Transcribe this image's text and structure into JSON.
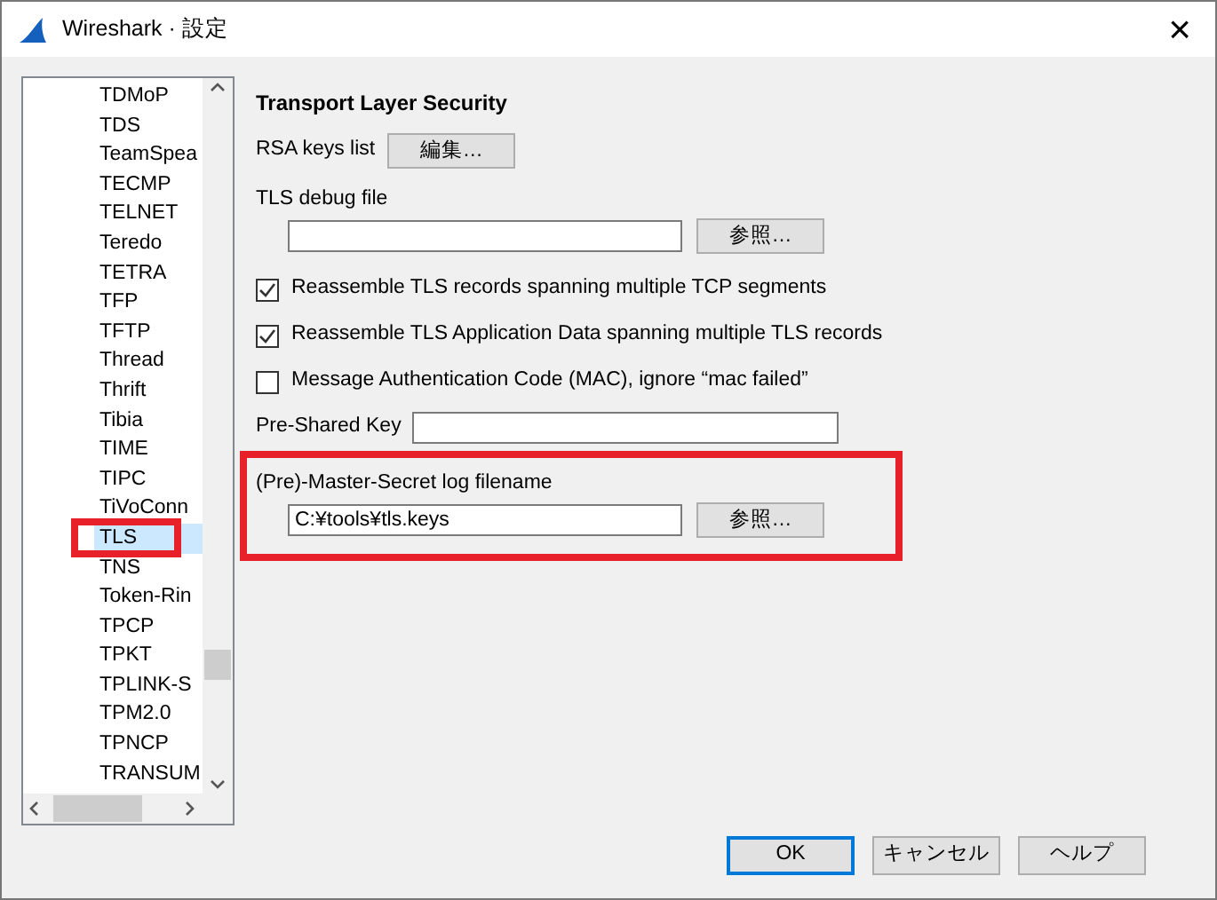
{
  "window": {
    "title": "Wireshark · 設定",
    "close": "×"
  },
  "tree": {
    "items": [
      {
        "label": "TDMoP",
        "selected": false,
        "highlighted": false
      },
      {
        "label": "TDS",
        "selected": false,
        "highlighted": false
      },
      {
        "label": "TeamSpea",
        "selected": false,
        "highlighted": false
      },
      {
        "label": "TECMP",
        "selected": false,
        "highlighted": false
      },
      {
        "label": "TELNET",
        "selected": false,
        "highlighted": false
      },
      {
        "label": "Teredo",
        "selected": false,
        "highlighted": false
      },
      {
        "label": "TETRA",
        "selected": false,
        "highlighted": false
      },
      {
        "label": "TFP",
        "selected": false,
        "highlighted": false
      },
      {
        "label": "TFTP",
        "selected": false,
        "highlighted": false
      },
      {
        "label": "Thread",
        "selected": false,
        "highlighted": false
      },
      {
        "label": "Thrift",
        "selected": false,
        "highlighted": false
      },
      {
        "label": "Tibia",
        "selected": false,
        "highlighted": false
      },
      {
        "label": "TIME",
        "selected": false,
        "highlighted": false
      },
      {
        "label": "TIPC",
        "selected": false,
        "highlighted": false
      },
      {
        "label": "TiVoConn",
        "selected": false,
        "highlighted": false
      },
      {
        "label": "TLS",
        "selected": true,
        "highlighted": true
      },
      {
        "label": "TNS",
        "selected": false,
        "highlighted": false
      },
      {
        "label": "Token-Rin",
        "selected": false,
        "highlighted": false
      },
      {
        "label": "TPCP",
        "selected": false,
        "highlighted": false
      },
      {
        "label": "TPKT",
        "selected": false,
        "highlighted": false
      },
      {
        "label": "TPLINK-S",
        "selected": false,
        "highlighted": false
      },
      {
        "label": "TPM2.0",
        "selected": false,
        "highlighted": false
      },
      {
        "label": "TPNCP",
        "selected": false,
        "highlighted": false
      },
      {
        "label": "TRANSUM",
        "selected": false,
        "highlighted": false
      }
    ]
  },
  "panel": {
    "title": "Transport Layer Security",
    "rows": [
      {
        "kind": "button",
        "label": "RSA keys list",
        "button": "編集…"
      },
      {
        "kind": "file",
        "label": "TLS debug file",
        "value": "",
        "button": "参照…",
        "highlighted": false
      },
      {
        "kind": "checkbox",
        "label": "Reassemble TLS records spanning multiple TCP segments",
        "checked": true
      },
      {
        "kind": "checkbox",
        "label": "Reassemble TLS Application Data spanning multiple TLS records",
        "checked": true
      },
      {
        "kind": "checkbox",
        "label": "Message Authentication Code (MAC), ignore “mac failed”",
        "checked": false
      },
      {
        "kind": "text",
        "label": "Pre-Shared Key",
        "value": ""
      },
      {
        "kind": "file",
        "label": "(Pre)-Master-Secret log filename",
        "value": "C:¥tools¥tls.keys",
        "button": "参照…",
        "highlighted": true
      }
    ]
  },
  "buttons": [
    {
      "label": "OK",
      "default": true
    },
    {
      "label": "キャンセル",
      "default": false
    },
    {
      "label": "ヘルプ",
      "default": false
    }
  ]
}
